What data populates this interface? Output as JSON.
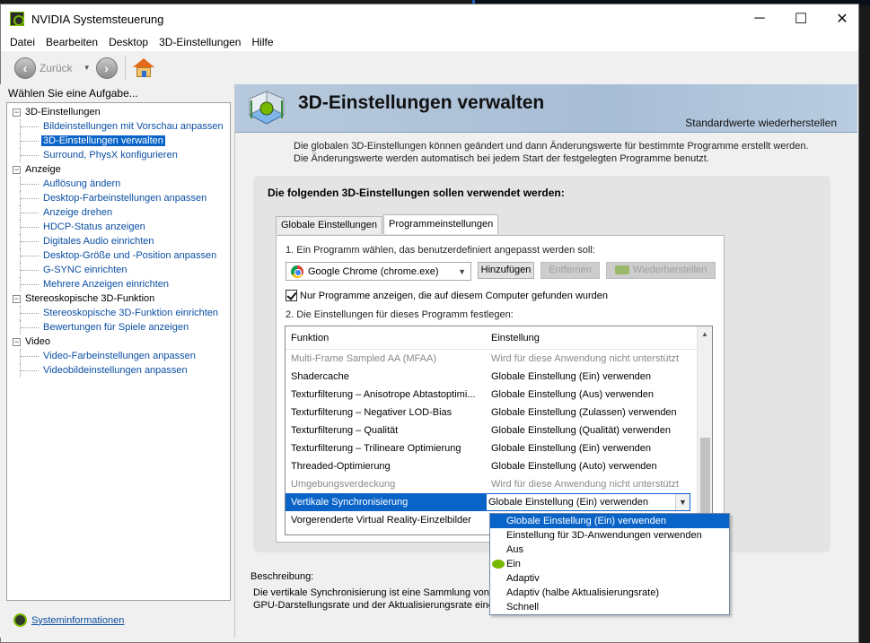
{
  "window": {
    "title": "NVIDIA Systemsteuerung",
    "controls": {
      "minimize": "─",
      "maximize": "☐",
      "close": "✕"
    }
  },
  "menu": [
    "Datei",
    "Bearbeiten",
    "Desktop",
    "3D-Einstellungen",
    "Hilfe"
  ],
  "toolbar": {
    "back_label": "Zurück"
  },
  "sidebar": {
    "header": "Wählen Sie eine Aufgabe...",
    "categories": [
      {
        "label": "3D-Einstellungen",
        "toggle": "−",
        "items": [
          "Bildeinstellungen mit Vorschau anpassen",
          "3D-Einstellungen verwalten",
          "Surround, PhysX konfigurieren"
        ]
      },
      {
        "label": "Anzeige",
        "toggle": "−",
        "items": [
          "Auflösung ändern",
          "Desktop-Farbeinstellungen anpassen",
          "Anzeige drehen",
          "HDCP-Status anzeigen",
          "Digitales Audio einrichten",
          "Desktop-Größe und -Position anpassen",
          "G-SYNC einrichten",
          "Mehrere Anzeigen einrichten"
        ]
      },
      {
        "label": "Stereoskopische 3D-Funktion",
        "toggle": "−",
        "items": [
          "Stereoskopische 3D-Funktion einrichten",
          "Bewertungen für Spiele anzeigen"
        ]
      },
      {
        "label": "Video",
        "toggle": "−",
        "items": [
          "Video-Farbeinstellungen anpassen",
          "Videobildeinstellungen anpassen"
        ]
      }
    ],
    "selected_item": "3D-Einstellungen verwalten",
    "sysinfo_link": "Systeminformationen"
  },
  "main": {
    "title": "3D-Einstellungen verwalten",
    "restore_defaults": "Standardwerte wiederherstellen",
    "intro": "Die globalen 3D-Einstellungen können geändert und dann Änderungswerte für bestimmte Programme erstellt werden. Die Änderungswerte werden automatisch bei jedem Start der festgelegten Programme benutzt.",
    "group_title": "Die folgenden 3D-Einstellungen sollen verwendet werden:",
    "tabs": [
      {
        "label": "Globale Einstellungen",
        "active": false
      },
      {
        "label": "Programmeinstellungen",
        "active": true
      }
    ],
    "step1": "1. Ein Programm wählen, das benutzerdefiniert angepasst werden soll:",
    "program_selected": "Google Chrome (chrome.exe)",
    "btn_add": "Hinzufügen",
    "btn_remove": "Entfernen",
    "btn_restore": "Wiederherstellen",
    "checkbox_label": "Nur Programme anzeigen, die auf diesem Computer gefunden wurden",
    "step2": "2. Die Einstellungen für dieses Programm festlegen:",
    "table": {
      "col_function": "Funktion",
      "col_setting": "Einstellung",
      "rows": [
        {
          "f": "Multi-Frame Sampled AA (MFAA)",
          "e": "Wird für diese Anwendung nicht unterstützt",
          "disabled": true
        },
        {
          "f": "Shadercache",
          "e": "Globale Einstellung (Ein) verwenden"
        },
        {
          "f": "Texturfilterung – Anisotrope Abtastoptimi...",
          "e": "Globale Einstellung (Aus) verwenden"
        },
        {
          "f": "Texturfilterung – Negativer LOD-Bias",
          "e": "Globale Einstellung (Zulassen) verwenden"
        },
        {
          "f": "Texturfilterung – Qualität",
          "e": "Globale Einstellung (Qualität) verwenden"
        },
        {
          "f": "Texturfilterung – Trilineare Optimierung",
          "e": "Globale Einstellung (Ein) verwenden"
        },
        {
          "f": "Threaded-Optimierung",
          "e": "Globale Einstellung (Auto) verwenden"
        },
        {
          "f": "Umgebungsverdeckung",
          "e": "Wird für diese Anwendung nicht unterstützt",
          "disabled": true
        },
        {
          "f": "Vertikale Synchronisierung",
          "e": "Globale Einstellung (Ein) verwenden",
          "selected": true
        },
        {
          "f": "Vorgerenderte Virtual Reality-Einzelbilder",
          "e": ""
        }
      ]
    },
    "desc_label": "Beschreibung:",
    "desc_line1": "Die vertikale Synchronisierung ist eine Sammlung von Ei",
    "desc_line2": "GPU-Darstellungsrate und der Aktualisierungsrate eines"
  },
  "dropdown_options": [
    {
      "label": "Globale Einstellung (Ein) verwenden",
      "selected": true
    },
    {
      "label": "Einstellung für 3D-Anwendungen verwenden"
    },
    {
      "label": "Aus"
    },
    {
      "label": "Ein",
      "nvidia_marker": true
    },
    {
      "label": "Adaptiv"
    },
    {
      "label": "Adaptiv (halbe Aktualisierungsrate)"
    },
    {
      "label": "Schnell"
    }
  ],
  "colors": {
    "selection": "#0a64c8",
    "link": "#0b4fa3",
    "nvidia_green": "#76b900"
  }
}
